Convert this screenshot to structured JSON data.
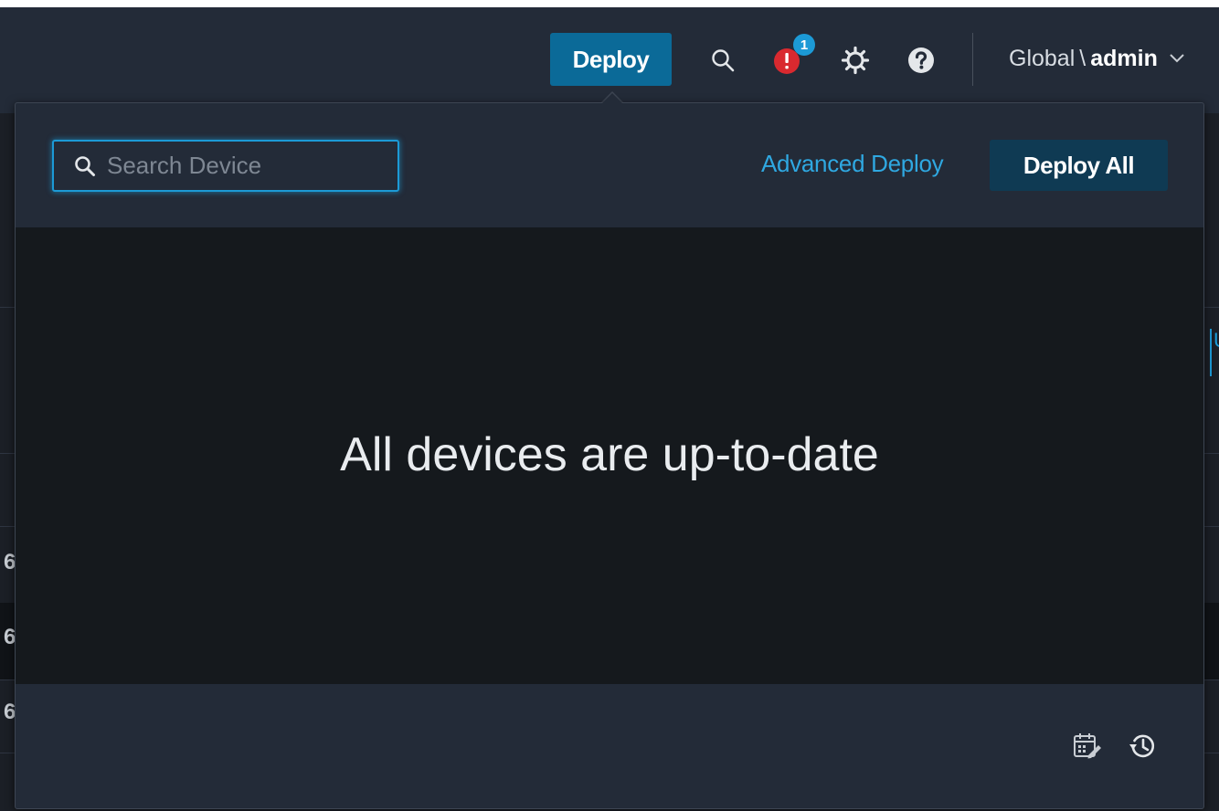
{
  "header": {
    "deploy_label": "Deploy",
    "notification_count": "1",
    "user_menu": {
      "domain": "Global",
      "separator": "\\",
      "username": "admin"
    }
  },
  "deploy_popover": {
    "search": {
      "placeholder": "Search Device",
      "value": ""
    },
    "advanced_deploy_label": "Advanced Deploy",
    "deploy_all_label": "Deploy All",
    "empty_message": "All devices are up-to-date"
  },
  "icons": {
    "header": [
      "search-icon",
      "alert-icon",
      "gear-icon",
      "help-icon",
      "chevron-down-icon"
    ],
    "popover_footer": [
      "schedule-edit-icon",
      "history-icon"
    ]
  },
  "colors": {
    "accent": "#1c9ad6",
    "deploy_button": "#0b6a98",
    "deploy_all_button": "#0f3a53",
    "alert": "#d9292f",
    "header_bg": "#232b38",
    "body_bg": "#15191d"
  }
}
